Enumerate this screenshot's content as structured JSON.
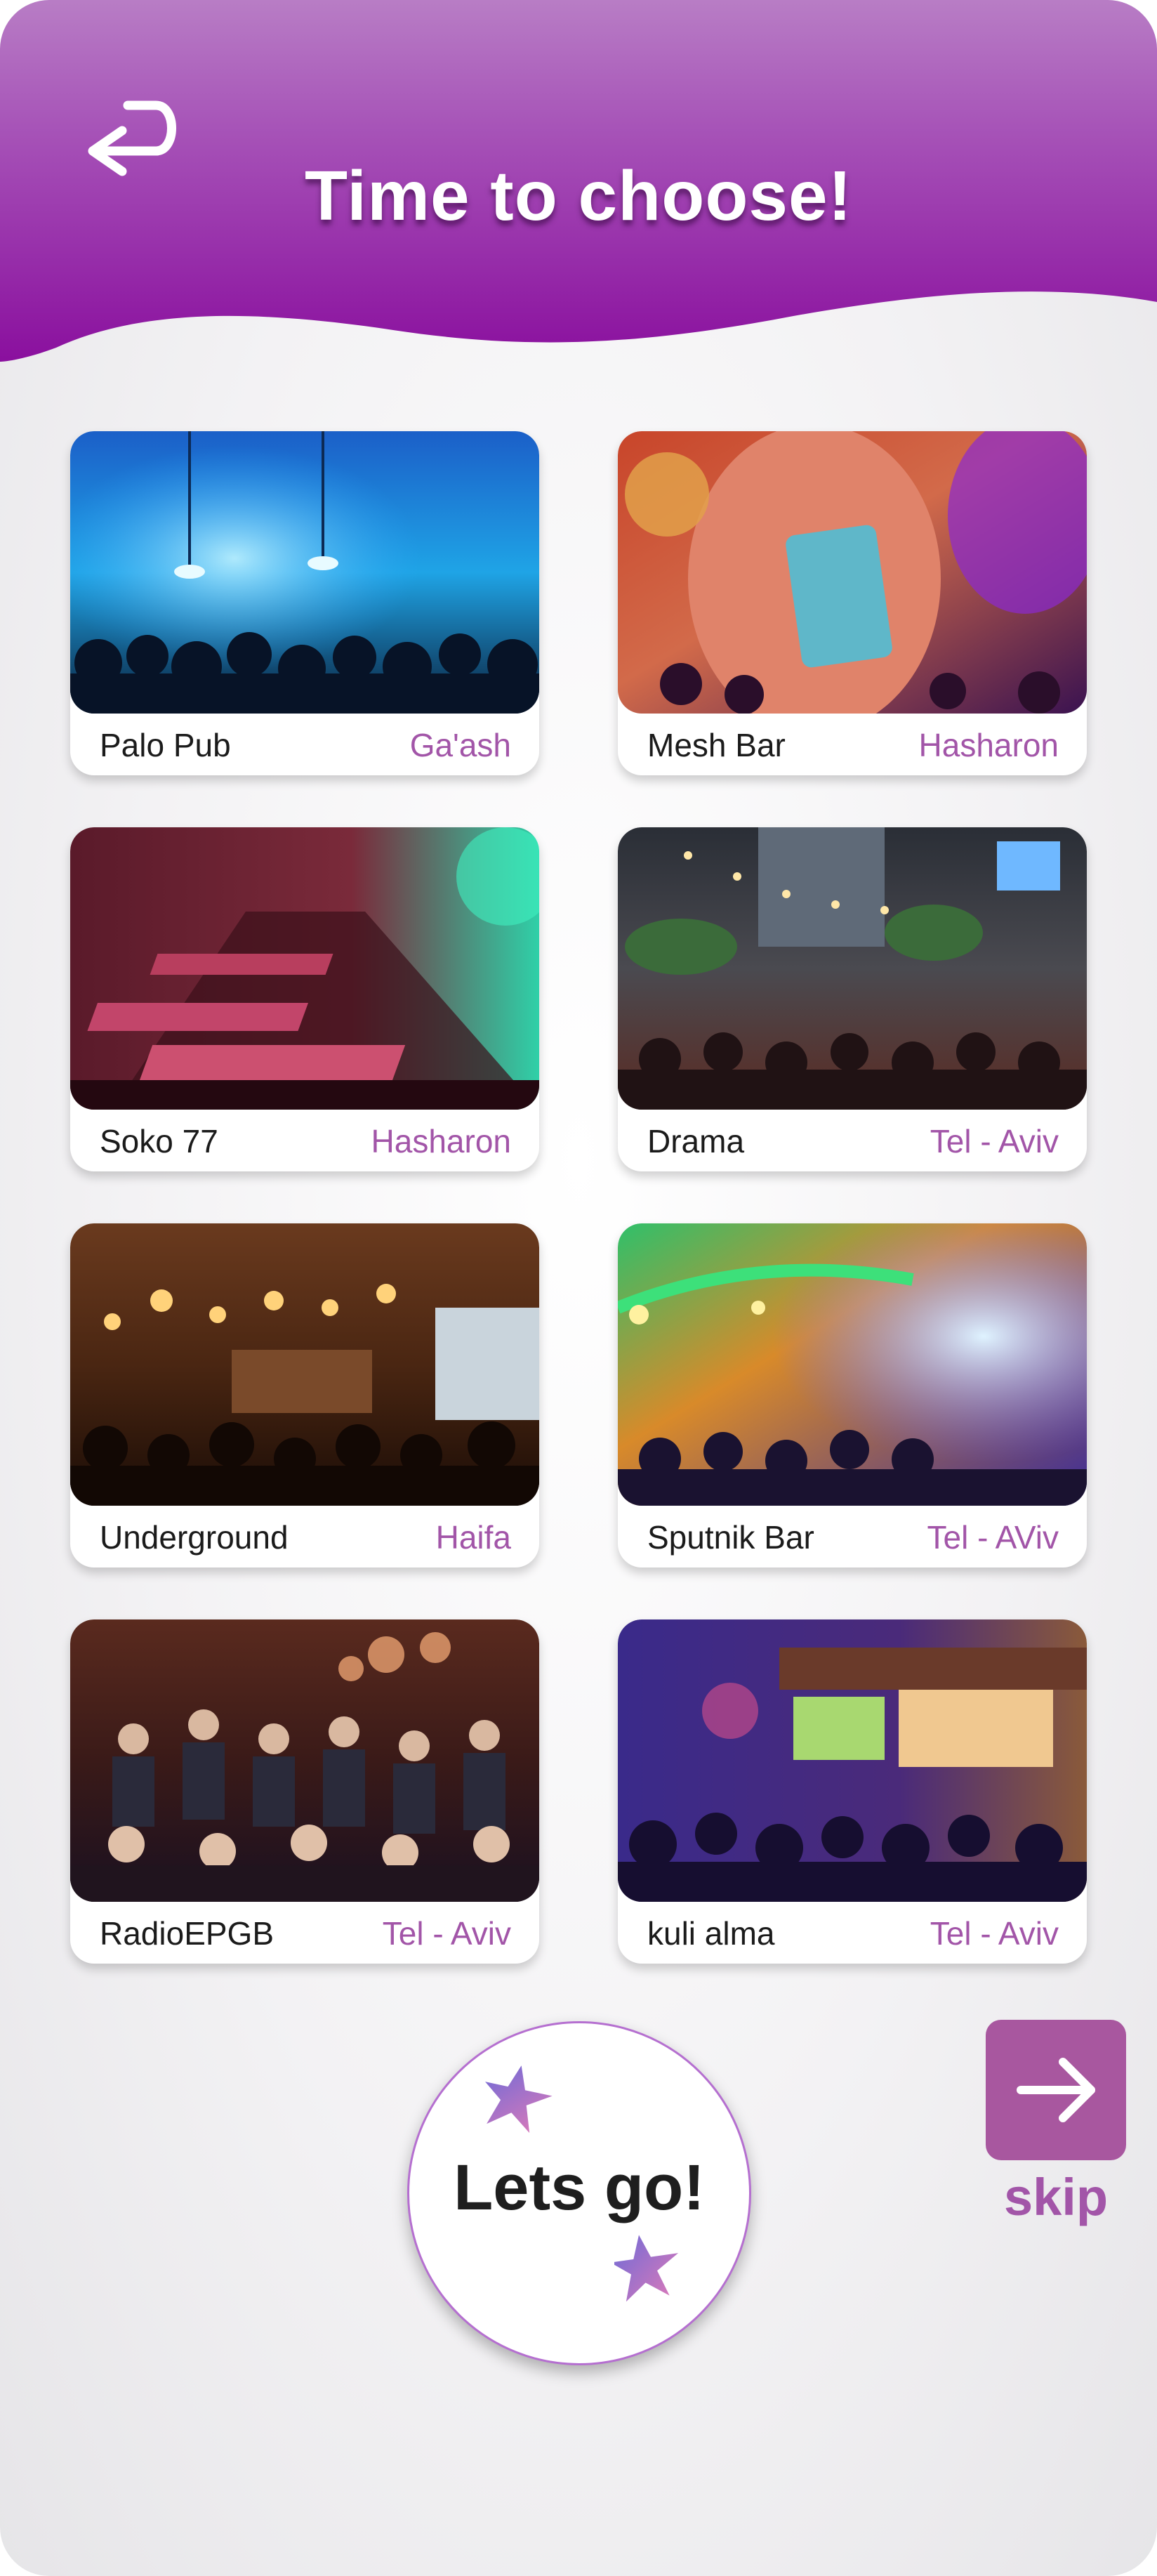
{
  "header": {
    "title": "Time to choose!",
    "back_icon": "return-arrow-icon"
  },
  "colors": {
    "header_top": "#b87dc5",
    "header_bottom": "#8a0f9e",
    "accent": "#a255a8",
    "skip_button": "#a8579f"
  },
  "places": [
    {
      "name": "Palo Pub",
      "city": "Ga'ash"
    },
    {
      "name": "Mesh Bar",
      "city": "Hasharon"
    },
    {
      "name": "Soko 77",
      "city": "Hasharon"
    },
    {
      "name": "Drama",
      "city": "Tel - Aviv"
    },
    {
      "name": "Underground",
      "city": "Haifa"
    },
    {
      "name": "Sputnik Bar",
      "city": "Tel - AViv"
    },
    {
      "name": "RadioEPGB",
      "city": "Tel - Aviv"
    },
    {
      "name": "kuli alma",
      "city": "Tel - Aviv"
    }
  ],
  "actions": {
    "go_label": "Lets go!",
    "skip_label": "skip",
    "skip_icon": "arrow-right-icon",
    "star_icon": "star-icon"
  }
}
